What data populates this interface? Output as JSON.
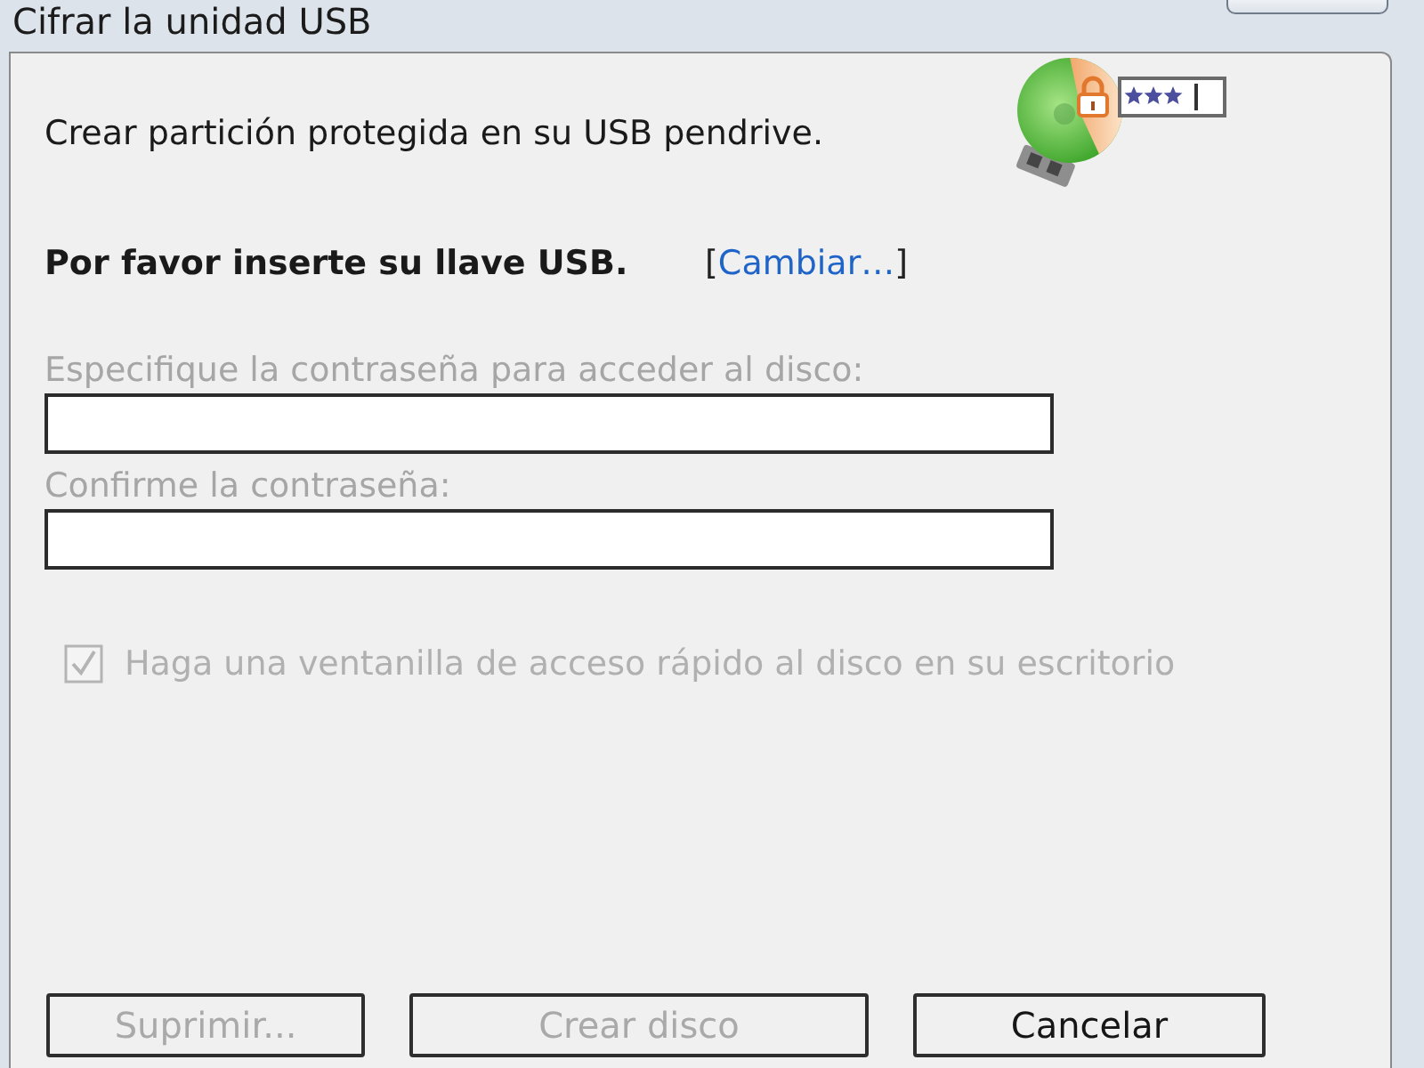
{
  "window": {
    "title": "Cifrar la unidad USB"
  },
  "intro": "Crear partición protegida en su USB pendrive.",
  "usb_status": {
    "message": "Por favor inserte su llave USB.",
    "change_link": {
      "open": "[",
      "label": "Cambiar…",
      "close": "]"
    }
  },
  "fields": [
    {
      "label": "Especifique la contraseña para acceder al disco:",
      "disabled": true
    },
    {
      "label": "Confirme la contraseña:",
      "disabled": true
    }
  ],
  "shortcut_option": {
    "label": "Haga una ventanilla de acceso rápido al disco en su escritorio",
    "checked": true,
    "disabled": true
  },
  "buttons": [
    {
      "label": "Suprimir...",
      "disabled": true
    },
    {
      "label": "Crear disco",
      "disabled": true
    },
    {
      "label": "Cancelar",
      "disabled": false
    }
  ]
}
